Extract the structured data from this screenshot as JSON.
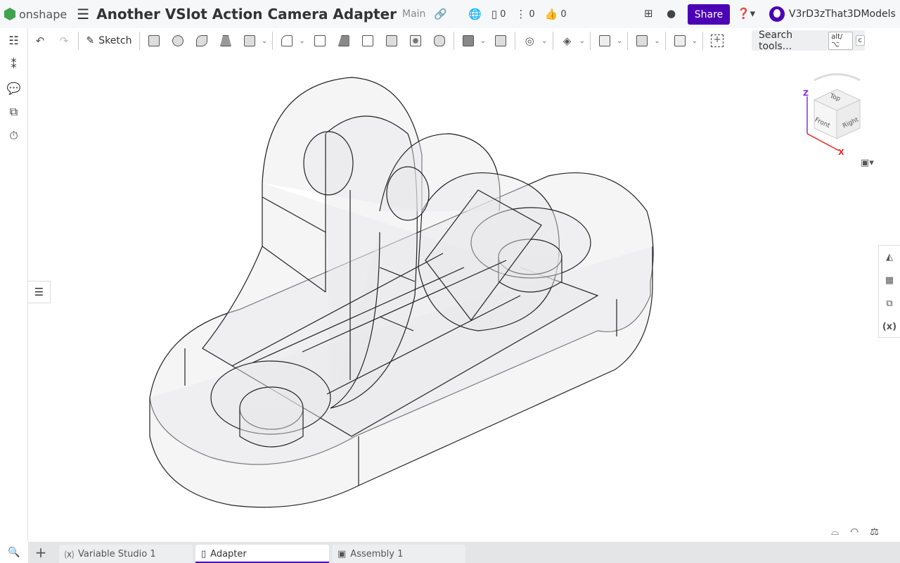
{
  "header": {
    "brand": "onshape",
    "title": "Another VSlot Action Camera Adapter",
    "branch": "Main",
    "versions_count": "0",
    "branches_count": "0",
    "likes_count": "0",
    "share_label": "Share",
    "user_name": "V3rD3zThat3DModels"
  },
  "toolbar": {
    "sketch_label": "Sketch",
    "search_placeholder": "Search tools...",
    "search_shortcut": "alt/⌥",
    "search_key": "c",
    "tools": [
      "extrude",
      "revolve",
      "sweep",
      "loft",
      "thicken",
      "fillet",
      "chamfer",
      "draft",
      "rib",
      "shell",
      "hole",
      "thread",
      "boolean",
      "split",
      "transform",
      "pattern",
      "plane",
      "mate-connector",
      "sheet-metal",
      "add-custom"
    ]
  },
  "viewcube": {
    "top": "Top",
    "front": "Front",
    "right": "Right",
    "axis_z": "Z",
    "axis_x": "X"
  },
  "tabs": [
    {
      "label": "Variable Studio 1",
      "icon": "variable-studio-icon"
    },
    {
      "label": "Adapter",
      "icon": "part-studio-icon",
      "active": true
    },
    {
      "label": "Assembly 1",
      "icon": "assembly-icon"
    }
  ],
  "colors": {
    "accent": "#4b00b5",
    "logo": "#3fa34d"
  }
}
